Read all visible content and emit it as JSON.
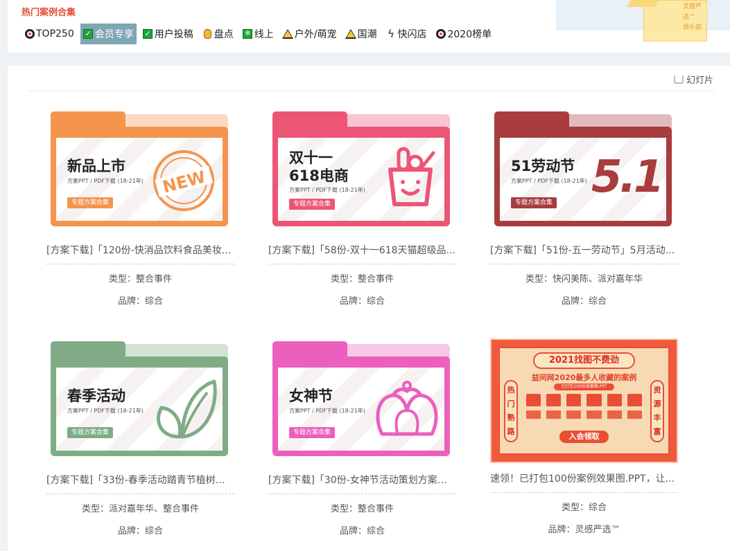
{
  "section": {
    "title": "热门案例合集"
  },
  "tags": [
    {
      "label": "TOP250",
      "icon": "ring-icon"
    },
    {
      "label": "会员专享",
      "icon": "checkbox-icon",
      "active": true
    },
    {
      "label": "用户投稿",
      "icon": "checkbox-icon"
    },
    {
      "label": "盘点",
      "icon": "hand-icon"
    },
    {
      "label": "线上",
      "icon": "sparkle-icon"
    },
    {
      "label": "户外/萌宠",
      "icon": "warning-icon"
    },
    {
      "label": "国潮",
      "icon": "warning-icon"
    },
    {
      "label": "快闪店",
      "icon": "bolt-icon"
    },
    {
      "label": "2020榜单",
      "icon": "ring-icon"
    }
  ],
  "promo": {
    "line1": "灵感严选™",
    "line2": "俱乐部"
  },
  "toolbar": {
    "slideshow_label": "幻灯片"
  },
  "colors": {
    "accent_red": "#e24e3a",
    "active_tag": "#7ea6b3"
  },
  "cards": [
    {
      "title": "[方案下载]「120份-快消品饮料食品美妆...",
      "type_label": "类型：整合事件",
      "brand_label": "品牌：综合",
      "thumb": {
        "heading": "新品上市",
        "sub": "方案PPT / PDF下载 (18-21年)",
        "button": "专题方案合集",
        "badge": "NEW",
        "color": "#f5944d"
      }
    },
    {
      "title": "[方案下载]「58份-双十一618天猫超级品...",
      "type_label": "类型：整合事件",
      "brand_label": "品牌：综合",
      "thumb": {
        "heading_line1": "双十一",
        "heading_line2": "618电商",
        "sub": "方案PPT / PDF下载 (18-21年)",
        "button": "专题方案合集",
        "color": "#ec5576"
      }
    },
    {
      "title": "[方案下载]「51份-五一劳动节」5月活动...",
      "type_label": "类型：快闪美陈、派对嘉年华",
      "brand_label": "品牌：综合",
      "thumb": {
        "heading": "51劳动节",
        "sub": "方案PPT / PDF下载 (18-21年)",
        "button": "专题方案合集",
        "badge": "5.1",
        "color": "#a83c3e"
      }
    },
    {
      "title": "[方案下载]「33份-春季活动踏青节植树节...",
      "type_label": "类型：派对嘉年华、整合事件",
      "brand_label": "品牌：综合",
      "thumb": {
        "heading": "春季活动",
        "sub": "方案PPT / PDF下载 (18-21年)",
        "button": "专题方案合集",
        "color": "#7fac86"
      }
    },
    {
      "title": "[方案下载]「30份-女神节活动策划方案」...",
      "type_label": "类型：整合事件",
      "brand_label": "品牌：综合",
      "thumb": {
        "heading": "女神节",
        "sub": "方案PPT / PDF下载 (18-21年)",
        "button": "专题方案合集",
        "color": "#eb5fbd"
      }
    },
    {
      "title": "速领！已打包100份案例效果图.PPT，让...",
      "type_label": "类型：综合",
      "brand_label": "品牌：灵感严选™",
      "thumb": {
        "title": "2021找图不费劲",
        "subtitle": "益间网2020最多人收藏的案例",
        "ribbon": "已打包100份效果图.PPT",
        "left_side": [
          "热",
          "门",
          "熟",
          "路"
        ],
        "right_side": [
          "资",
          "源",
          "丰",
          "富"
        ],
        "button": "入会领取"
      }
    }
  ]
}
